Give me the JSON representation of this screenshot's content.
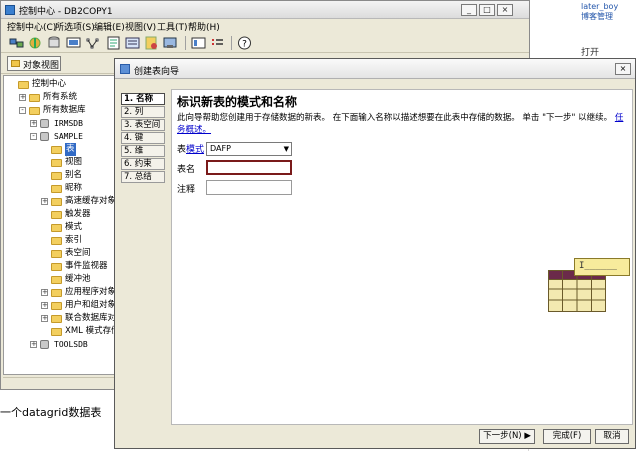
{
  "background_page": {
    "user_link": "later_boy",
    "user_sub": "博客管理",
    "open_text": "打开",
    "caption": "一个datagrid数据表"
  },
  "main_window": {
    "title": "控制中心 - DB2COPY1",
    "controls": {
      "minimize": "_",
      "maximize": "□",
      "close": "×"
    },
    "menu": [
      "控制中心(C)",
      "所选项(S)",
      "编辑(E)",
      "视图(V)",
      "工具(T)",
      "帮助(H)"
    ],
    "object_view_label": "对象视图"
  },
  "tree": [
    {
      "label": "控制中心",
      "indent": 0,
      "expander": "",
      "icon": "folder"
    },
    {
      "label": "所有系统",
      "indent": 1,
      "expander": "+",
      "icon": "folder"
    },
    {
      "label": "所有数据库",
      "indent": 1,
      "expander": "-",
      "icon": "folder"
    },
    {
      "label": "IRMSDB",
      "indent": 2,
      "expander": "+",
      "icon": "db",
      "mono": true
    },
    {
      "label": "SAMPLE",
      "indent": 2,
      "expander": "-",
      "icon": "db",
      "mono": true
    },
    {
      "label": "表",
      "indent": 3,
      "expander": "",
      "icon": "folder-open",
      "selected": true
    },
    {
      "label": "视图",
      "indent": 3,
      "expander": "",
      "icon": "folder"
    },
    {
      "label": "别名",
      "indent": 3,
      "expander": "",
      "icon": "folder"
    },
    {
      "label": "昵称",
      "indent": 3,
      "expander": "",
      "icon": "folder"
    },
    {
      "label": "高速缓存对象",
      "indent": 3,
      "expander": "+",
      "icon": "folder"
    },
    {
      "label": "触发器",
      "indent": 3,
      "expander": "",
      "icon": "folder"
    },
    {
      "label": "模式",
      "indent": 3,
      "expander": "",
      "icon": "folder"
    },
    {
      "label": "索引",
      "indent": 3,
      "expander": "",
      "icon": "folder"
    },
    {
      "label": "表空间",
      "indent": 3,
      "expander": "",
      "icon": "folder"
    },
    {
      "label": "事件监视器",
      "indent": 3,
      "expander": "",
      "icon": "folder"
    },
    {
      "label": "缓冲池",
      "indent": 3,
      "expander": "",
      "icon": "folder"
    },
    {
      "label": "应用程序对象",
      "indent": 3,
      "expander": "+",
      "icon": "folder"
    },
    {
      "label": "用户和组对象",
      "indent": 3,
      "expander": "+",
      "icon": "folder"
    },
    {
      "label": "联合数据库对象",
      "indent": 3,
      "expander": "+",
      "icon": "folder"
    },
    {
      "label": "XML 模式存储库",
      "indent": 3,
      "expander": "",
      "icon": "folder"
    },
    {
      "label": "TOOLSDB",
      "indent": 2,
      "expander": "+",
      "icon": "db",
      "mono": true
    }
  ],
  "wizard": {
    "title": "创建表向导",
    "close": "×",
    "steps": [
      "1. 名称",
      "2. 列",
      "3. 表空间",
      "4. 键",
      "5. 维",
      "6. 约束",
      "7. 总结"
    ],
    "active_step": 0,
    "heading": "标识新表的模式和名称",
    "description": "此向导帮助您创建用于存储数据的新表。 在下面输入名称以描述想要在此表中存储的数据。 单击 \"下一步\" 以继续。",
    "description_link": "任务概述。",
    "schema_label_prefix": "表",
    "schema_label_link": "模式",
    "schema_value": "DAFP",
    "tablename_label": "表名",
    "tablename_value": "",
    "comment_label": "注释",
    "comment_value": "",
    "art_tag_text": "I______",
    "buttons": {
      "next": "下一步(N) ▶",
      "finish": "完成(F)",
      "cancel": "取消"
    }
  },
  "colors": {
    "selection": "#316ac5",
    "link": "#0000cc",
    "tablename_border": "#7a1a1a",
    "art_header": "#6b2a4a"
  }
}
